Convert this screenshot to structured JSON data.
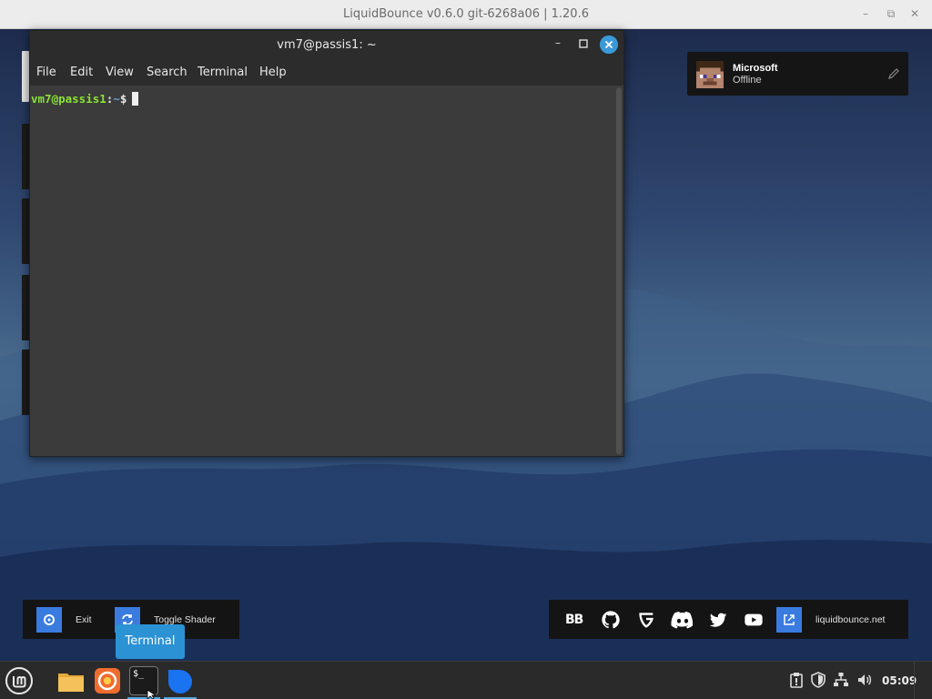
{
  "outer_window": {
    "title": "LiquidBounce v0.6.0 git-6268a06 | 1.20.6",
    "minimize_glyph": "–",
    "restore_glyph": "⧉",
    "close_glyph": "✕"
  },
  "account": {
    "name": "Microsoft",
    "status": "Offline",
    "avatar_icon": "steve-head-icon",
    "edit_icon": "pencil-icon"
  },
  "terminal": {
    "title": "vm7@passis1: ~",
    "menu": [
      "File",
      "Edit",
      "View",
      "Search",
      "Terminal",
      "Help"
    ],
    "prompt_user": "vm7@passis1",
    "prompt_sep": ":",
    "prompt_path": "~",
    "prompt_symbol": "$",
    "minimize_glyph": "–"
  },
  "bottom_left": {
    "exit_label": "Exit",
    "shader_label": "Toggle Shader"
  },
  "tooltip": {
    "text": "Terminal"
  },
  "bottom_right": {
    "social_icons": [
      "guilded-bb-icon",
      "github-icon",
      "guilded-icon",
      "discord-icon",
      "twitter-icon",
      "youtube-icon"
    ],
    "bb_glyph": "BB",
    "site_label": "liquidbounce.net"
  },
  "taskbar": {
    "apps": [
      "mint-menu-icon",
      "files-icon",
      "firefox-icon",
      "terminal-icon",
      "app-icon"
    ],
    "terminal_glyph": "$_",
    "clock": "05:09"
  },
  "colors": {
    "accent": "#3a7be0",
    "tooltip": "#2b92d4",
    "prompt_user": "#8ae234",
    "prompt_path": "#729fcf",
    "close_button": "#3a9ad9"
  }
}
